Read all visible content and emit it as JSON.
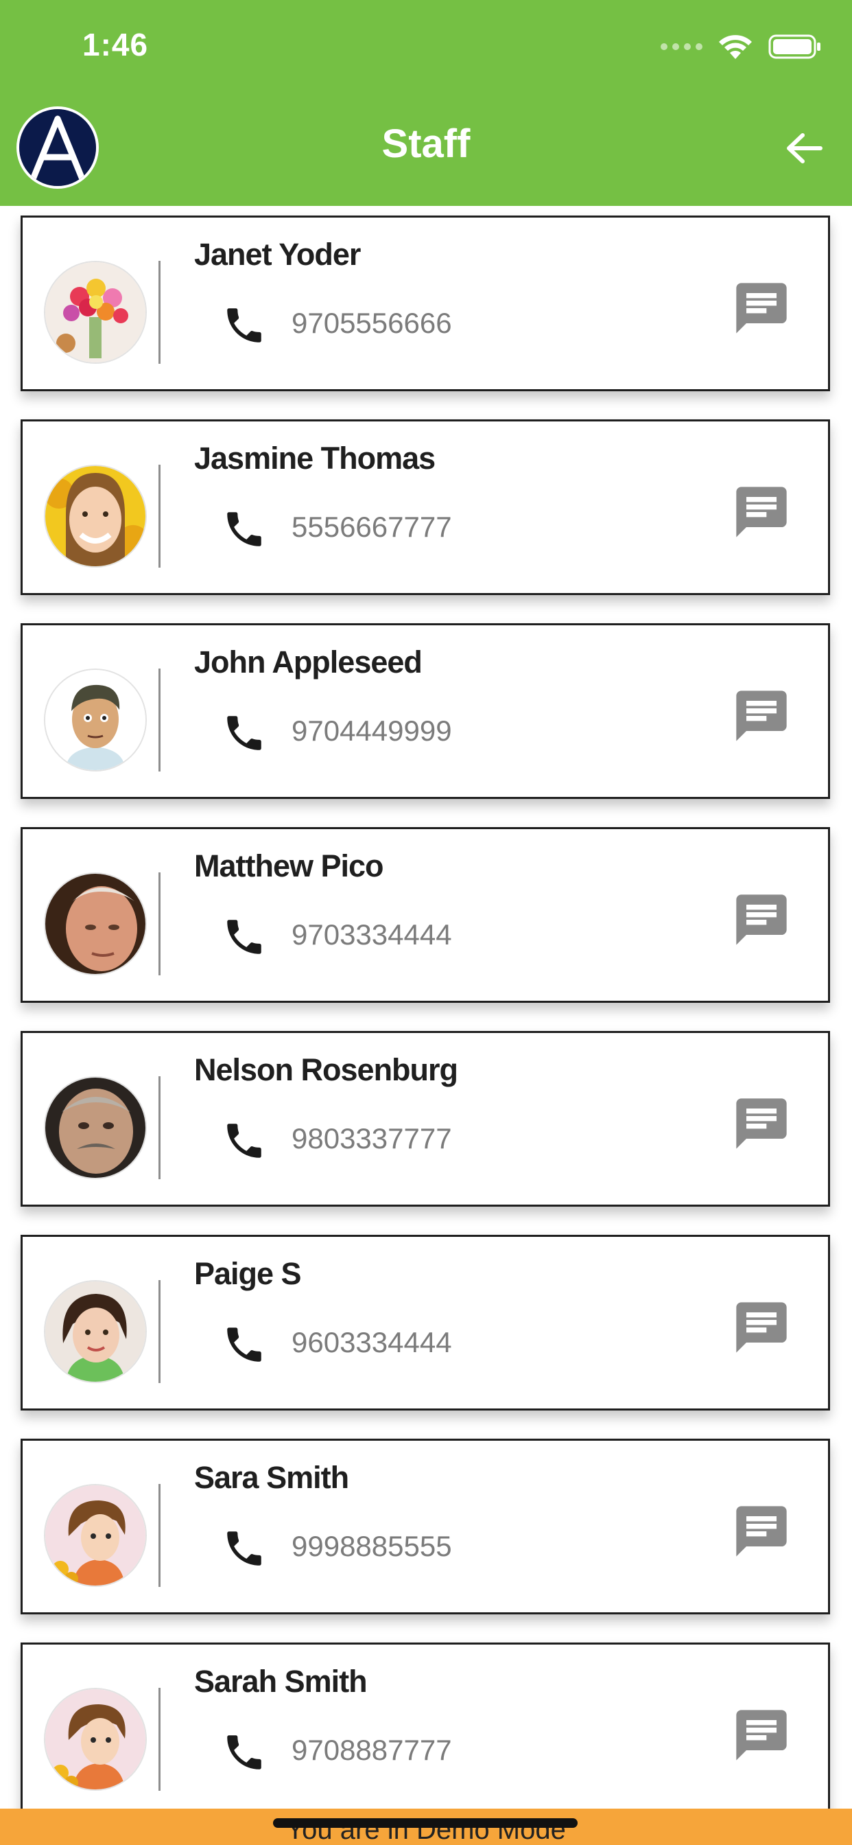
{
  "status_bar": {
    "time": "1:46"
  },
  "header": {
    "title": "Staff",
    "logo_letter": "A"
  },
  "staff": [
    {
      "name": "Janet Yoder",
      "phone": "9705556666",
      "avatar": "flowers-bouquet"
    },
    {
      "name": "Jasmine Thomas",
      "phone": "5556667777",
      "avatar": "woman-sunflowers"
    },
    {
      "name": "John Appleseed",
      "phone": "9704449999",
      "avatar": "cartoon-man"
    },
    {
      "name": "Matthew Pico",
      "phone": "9703334444",
      "avatar": "older-man"
    },
    {
      "name": "Nelson Rosenburg",
      "phone": "9803337777",
      "avatar": "mustache-man"
    },
    {
      "name": "Paige S",
      "phone": "9603334444",
      "avatar": "young-girl"
    },
    {
      "name": "Sara Smith",
      "phone": "9998885555",
      "avatar": "cartoon-woman"
    },
    {
      "name": "Sarah Smith",
      "phone": "9708887777",
      "avatar": "cartoon-woman"
    }
  ],
  "footer": {
    "demo_text": "You are in Demo Mode"
  },
  "colors": {
    "header": "#75c044",
    "demo_bar": "#f6a53a",
    "icon_gray": "#8a8a8a"
  }
}
